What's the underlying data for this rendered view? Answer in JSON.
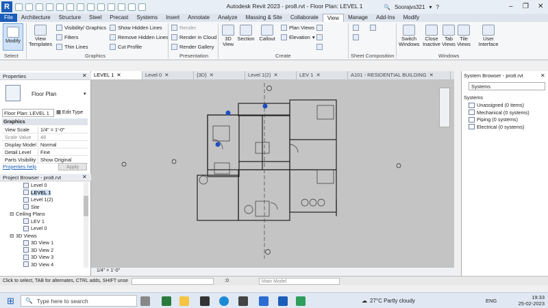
{
  "title_bar": {
    "app_title": "Autodesk Revit 2023 - pro8.rvt - Floor Plan: LEVEL 1",
    "user": "Soorajvs321"
  },
  "ribbon_tabs": [
    "File",
    "Architecture",
    "Structure",
    "Steel",
    "Precast",
    "Systems",
    "Insert",
    "Annotate",
    "Analyze",
    "Massing & Site",
    "Collaborate",
    "View",
    "Manage",
    "Add-Ins",
    "Modify"
  ],
  "active_tab": "View",
  "ribbon": {
    "modify": "Modify",
    "select": "Select",
    "view_templates": "View Templates",
    "visibility_graphics": "Visibility/ Graphics",
    "filters": "Filters",
    "thin_lines": "Thin Lines",
    "show_hidden_lines": "Show Hidden Lines",
    "remove_hidden_lines": "Remove Hidden Lines",
    "cut_profile": "Cut Profile",
    "graphics": "Graphics",
    "render": "Render",
    "render_in_cloud": "Render in Cloud",
    "render_gallery": "Render Gallery",
    "presentation": "Presentation",
    "view_3d": "3D View",
    "section": "Section",
    "callout": "Callout",
    "plan_views": "Plan Views",
    "elevation": "Elevation",
    "create": "Create",
    "sheet_composition": "Sheet Composition",
    "switch_windows": "Switch Windows",
    "close_inactive": "Close Inactive",
    "tab_views": "Tab Views",
    "tile_views": "Tile Views",
    "user_interface": "User Interface",
    "windows": "Windows"
  },
  "doc_tabs": [
    "LEVEL 1",
    "Level 0",
    "{3D}",
    "Level 1(2)",
    "LEV 1",
    "A101 - RESIDENTIAL BUILDING"
  ],
  "properties": {
    "header": "Properties",
    "type_name": "Floor Plan",
    "selector": "Floor Plan: LEVEL 1",
    "edit_type": "Edit Type",
    "group": "Graphics",
    "rows": [
      {
        "k": "View Scale",
        "v": "1/4\" = 1'-0\""
      },
      {
        "k": "Scale Value",
        "v": "48"
      },
      {
        "k": "Display Model",
        "v": "Normal"
      },
      {
        "k": "Detail Level",
        "v": "Fine"
      },
      {
        "k": "Parts Visibility",
        "v": "Show Original"
      }
    ],
    "help": "Properties help",
    "apply": "Apply"
  },
  "project_browser": {
    "header": "Project Browser - pro8.rvt",
    "items": [
      "Level 0",
      "LEVEL 1",
      "Level 1(2)",
      "Site",
      "Ceiling Plans",
      "LEV 1",
      "Level 0",
      "3D Views",
      "3D View 1",
      "3D View 2",
      "3D View 3",
      "3D View 4"
    ]
  },
  "system_browser": {
    "header": "System Browser - pro8.rvt",
    "dropdown": "Systems",
    "col": "Systems",
    "items": [
      "Unassigned (0 items)",
      "Mechanical (0 systems)",
      "Piping (0 systems)",
      "Electrical (0 systems)"
    ]
  },
  "view_control": {
    "scale": "1/4\" = 1'-0\""
  },
  "status": {
    "hint": "Click to select, TAB for alternates, CTRL adds, SHIFT unse",
    "workset_value": ":0",
    "model": "Main Model"
  },
  "taskbar": {
    "search": "Type here to search",
    "weather": "27°C  Partly cloudy",
    "lang": "ENG",
    "time": "19:33",
    "date": "25-02-2023"
  }
}
